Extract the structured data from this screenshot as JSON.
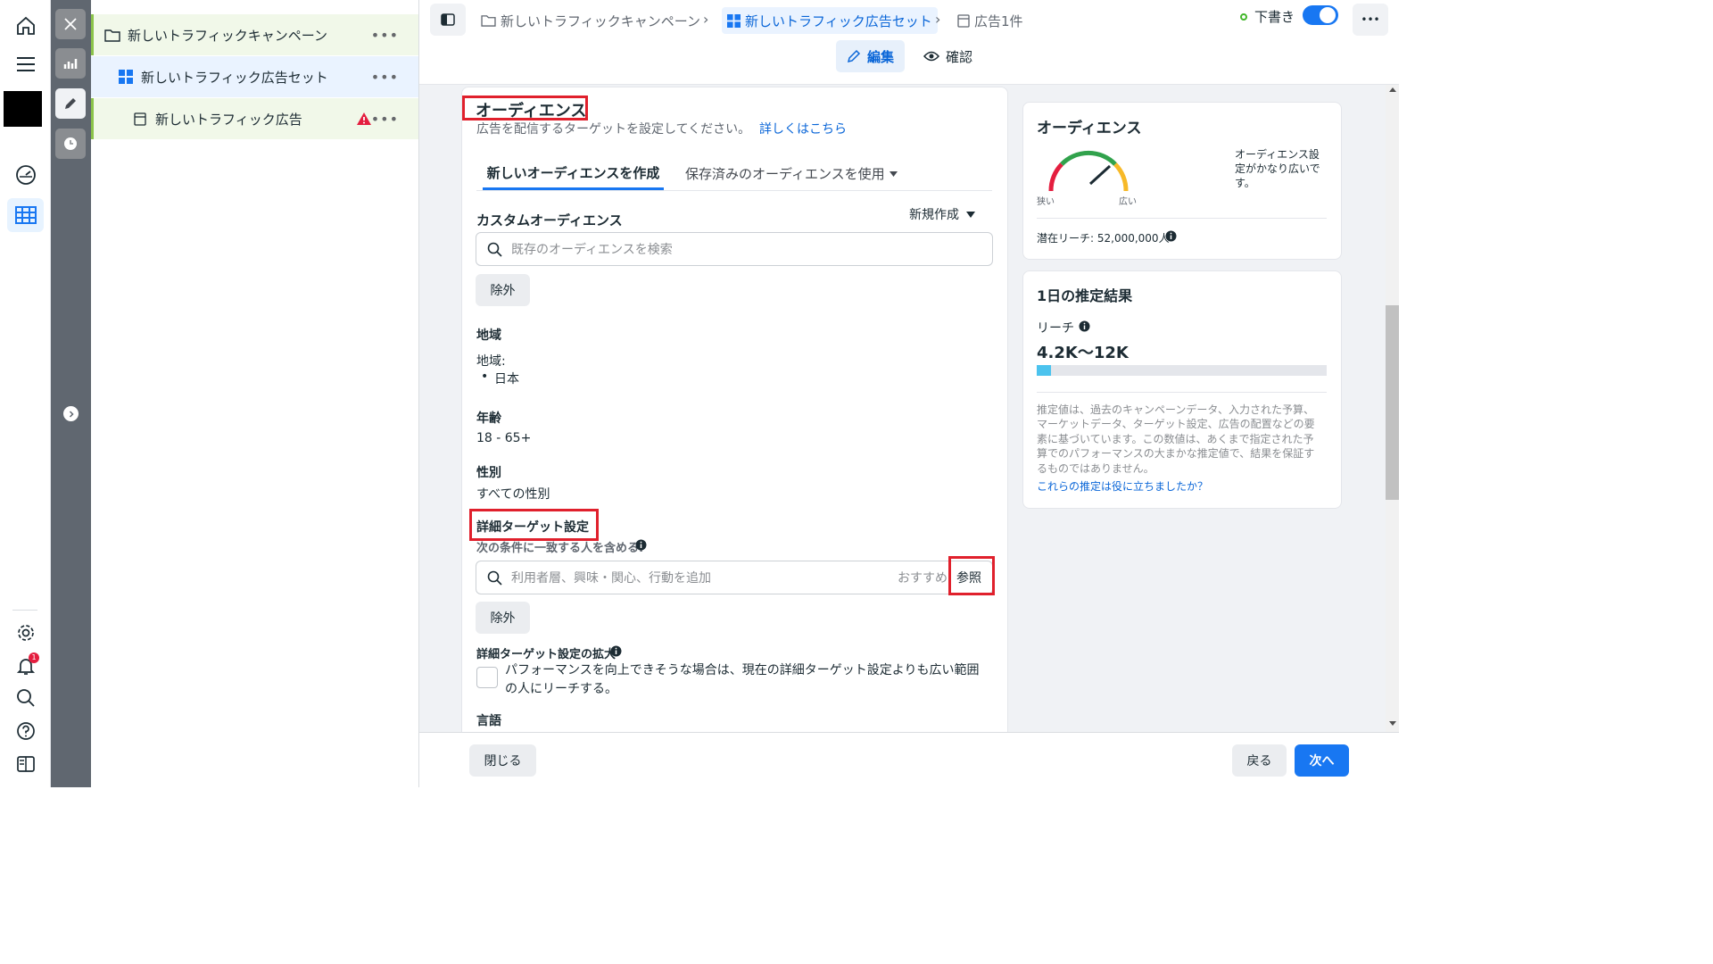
{
  "tree": {
    "campaign": "新しいトラフィックキャンペーン",
    "adset": "新しいトラフィック広告セット",
    "ad": "新しいトラフィック広告",
    "dots": "•••"
  },
  "header": {
    "crumb_campaign": "新しいトラフィックキャンペーン",
    "crumb_adset": "新しいトラフィック広告セット",
    "crumb_ad": "広告1件",
    "draft_label": "下書き",
    "more": "•••",
    "edit_label": "編集",
    "review_label": "確認"
  },
  "audience": {
    "title": "オーディエンス",
    "description": "広告を配信するターゲットを設定してください。",
    "learn_more": "詳しくはこちら",
    "tab_new": "新しいオーディエンスを作成",
    "tab_saved": "保存済みのオーディエンスを使用",
    "custom_label": "カスタムオーディエンス",
    "create_new": "新規作成",
    "search_placeholder": "既存のオーディエンスを検索",
    "exclude": "除外",
    "location_heading": "地域",
    "location_sub": "地域:",
    "location_value": "日本",
    "age_heading": "年齢",
    "age_value": "18 - 65+",
    "gender_heading": "性別",
    "gender_value": "すべての性別",
    "detailed_heading": "詳細ターゲット設定",
    "detailed_sub": "次の条件に一致する人を含める:",
    "detailed_placeholder": "利用者層、興味・関心、行動を追加",
    "suggest": "おすすめ",
    "browse": "参照",
    "exclude2": "除外",
    "expansion_heading": "詳細ターゲット設定の拡大",
    "expansion_text_1": "パフォーマンスを向上できそうな場合は、現在の詳細ターゲット設定よりも広い範囲",
    "expansion_text_2": "の人にリーチする。",
    "language_heading": "言語"
  },
  "side_audience": {
    "title": "オーディエンス",
    "gauge_low": "狭い",
    "gauge_high": "広い",
    "note": "オーディエンス設定がかなり広いです。",
    "potential_reach": "潜在リーチ: 52,000,000人"
  },
  "estimate": {
    "title": "1日の推定結果",
    "reach_label": "リーチ",
    "reach_value": "4.2K〜12K",
    "reach_fill": 0.05,
    "disclaimer": "推定値は、過去のキャンペーンデータ、入力された予算、マーケットデータ、ターゲット設定、広告の配置などの要素に基づいています。この数値は、あくまで指定された予算でのパフォーマンスの大まかな推定値で、結果を保証するものではありません。",
    "feedback": "これらの推定は役に立ちましたか？"
  },
  "footer": {
    "close": "閉じる",
    "back": "戻る",
    "next": "次へ"
  },
  "rail": {
    "notification_count": "1"
  },
  "colors": {
    "accent": "#1877f2",
    "highlight_red": "#e0202c",
    "draft_green": "#42b72a",
    "gauge_green": "#31a24c",
    "gauge_orange": "#f7b928",
    "reach_fill": "#4cc3ee"
  }
}
